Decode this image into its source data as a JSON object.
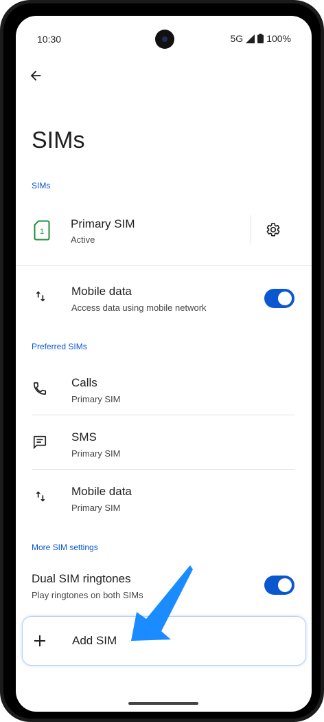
{
  "status_bar": {
    "time": "10:30",
    "network": "5G",
    "battery": "100%"
  },
  "page": {
    "title": "SIMs"
  },
  "sims_section": {
    "header": "SIMs",
    "primary_sim": {
      "icon_number": "1",
      "title": "Primary SIM",
      "subtitle": "Active"
    },
    "mobile_data": {
      "title": "Mobile data",
      "subtitle": "Access data using mobile network",
      "enabled": true
    }
  },
  "preferred_section": {
    "header": "Preferred SIMs",
    "items": [
      {
        "title": "Calls",
        "subtitle": "Primary SIM",
        "icon": "phone-icon"
      },
      {
        "title": "SMS",
        "subtitle": "Primary SIM",
        "icon": "message-icon"
      },
      {
        "title": "Mobile data",
        "subtitle": "Primary SIM",
        "icon": "data-arrows-icon"
      }
    ]
  },
  "more_section": {
    "header": "More SIM settings",
    "dual_ringtones": {
      "title": "Dual SIM ringtones",
      "subtitle": "Play ringtones on both SIMs",
      "enabled": true
    }
  },
  "add_sim": {
    "label": "Add SIM"
  },
  "colors": {
    "accent": "#0b57d0",
    "annotation_arrow": "#1a8cff"
  }
}
